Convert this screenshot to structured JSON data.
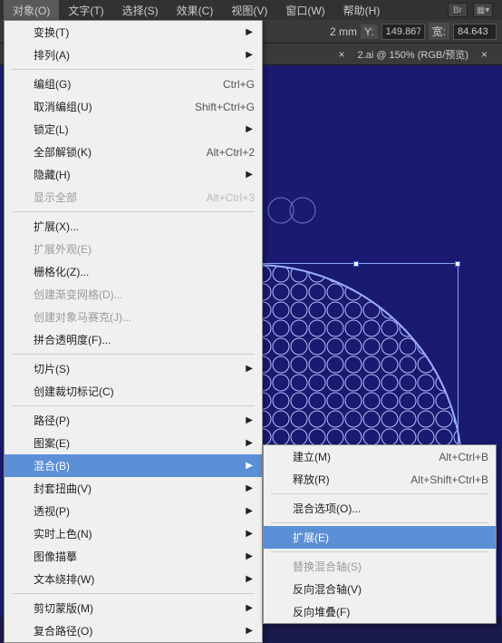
{
  "menubar": {
    "items": [
      "对象(O)",
      "文字(T)",
      "选择(S)",
      "效果(C)",
      "视图(V)",
      "窗口(W)",
      "帮助(H)"
    ]
  },
  "toolbar": {
    "x_suffix": "2 mm",
    "y_label": "Y:",
    "y_value": "149.867",
    "w_label": "宽:",
    "w_value": "84.643"
  },
  "tab": {
    "title": "2.ai @ 150% (RGB/预览)",
    "close": "×"
  },
  "menu": [
    {
      "label": "变换(T)",
      "sub": true
    },
    {
      "label": "排列(A)",
      "sub": true
    },
    {
      "sep": true
    },
    {
      "label": "编组(G)",
      "kbd": "Ctrl+G"
    },
    {
      "label": "取消编组(U)",
      "kbd": "Shift+Ctrl+G"
    },
    {
      "label": "锁定(L)",
      "sub": true
    },
    {
      "label": "全部解锁(K)",
      "kbd": "Alt+Ctrl+2"
    },
    {
      "label": "隐藏(H)",
      "sub": true
    },
    {
      "label": "显示全部",
      "kbd": "Alt+Ctrl+3",
      "disabled": true
    },
    {
      "sep": true
    },
    {
      "label": "扩展(X)..."
    },
    {
      "label": "扩展外观(E)",
      "disabled": true
    },
    {
      "label": "栅格化(Z)..."
    },
    {
      "label": "创建渐变网格(D)...",
      "disabled": true
    },
    {
      "label": "创建对象马赛克(J)...",
      "disabled": true
    },
    {
      "label": "拼合透明度(F)..."
    },
    {
      "sep": true
    },
    {
      "label": "切片(S)",
      "sub": true
    },
    {
      "label": "创建裁切标记(C)"
    },
    {
      "sep": true
    },
    {
      "label": "路径(P)",
      "sub": true
    },
    {
      "label": "图案(E)",
      "sub": true
    },
    {
      "label": "混合(B)",
      "sub": true,
      "highlight": true
    },
    {
      "label": "封套扭曲(V)",
      "sub": true
    },
    {
      "label": "透视(P)",
      "sub": true
    },
    {
      "label": "实时上色(N)",
      "sub": true
    },
    {
      "label": "图像描摹",
      "sub": true
    },
    {
      "label": "文本绕排(W)",
      "sub": true
    },
    {
      "sep": true
    },
    {
      "label": "剪切蒙版(M)",
      "sub": true
    },
    {
      "label": "复合路径(O)",
      "sub": true
    }
  ],
  "submenu": [
    {
      "label": "建立(M)",
      "kbd": "Alt+Ctrl+B"
    },
    {
      "label": "释放(R)",
      "kbd": "Alt+Shift+Ctrl+B"
    },
    {
      "sep": true
    },
    {
      "label": "混合选项(O)..."
    },
    {
      "sep": true
    },
    {
      "label": "扩展(E)",
      "highlight": true
    },
    {
      "sep": true
    },
    {
      "label": "替换混合轴(S)",
      "disabled": true
    },
    {
      "label": "反向混合轴(V)"
    },
    {
      "label": "反向堆叠(F)"
    }
  ]
}
